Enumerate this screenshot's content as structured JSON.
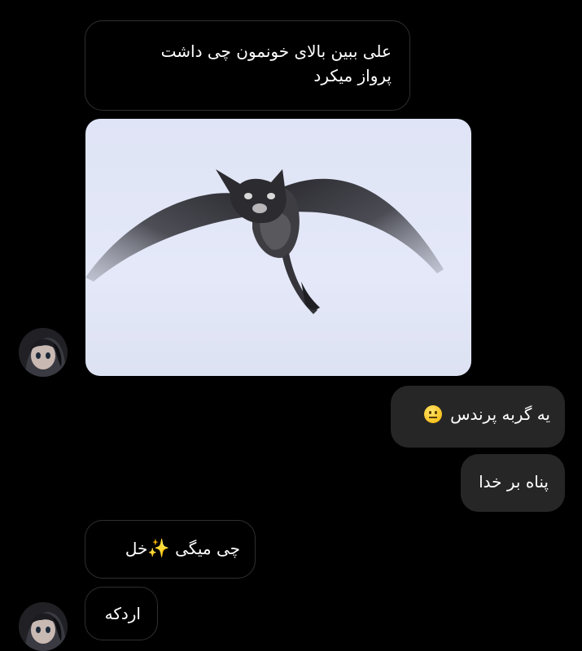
{
  "messages": [
    {
      "direction": "incoming",
      "lines": [
        "علی ببین بالای خونمون چی داشت",
        "پرواز میکرد"
      ]
    },
    {
      "direction": "incoming",
      "type": "image",
      "icon": "flying-cat-bird-photo"
    },
    {
      "direction": "outgoing",
      "text": "یه گربه پرندس",
      "emoji": "neutral-face-emoji"
    },
    {
      "direction": "outgoing",
      "text": "پناه بر خدا"
    },
    {
      "direction": "incoming",
      "text_before": "چی میگی ",
      "emoji": "sparkles-emoji",
      "text_after": "خل"
    },
    {
      "direction": "incoming",
      "text": "اردکه"
    }
  ],
  "colors": {
    "background": "#000000",
    "incoming_bubble_border": "#2f2f2f",
    "outgoing_bubble": "#262626",
    "text": "#ffffff"
  }
}
